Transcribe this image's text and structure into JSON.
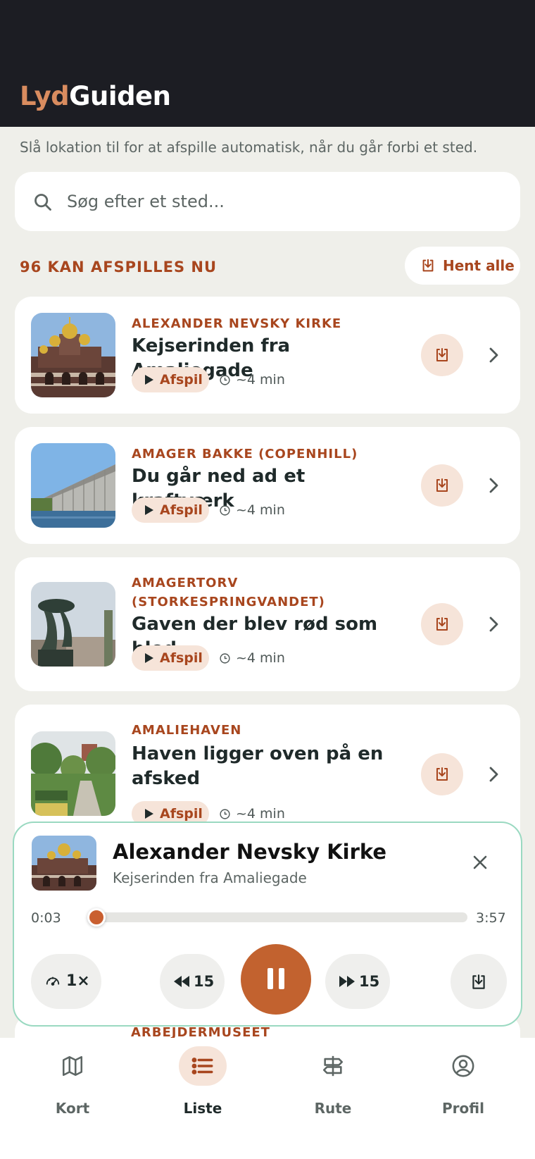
{
  "app": {
    "logo_part1": "Lyd",
    "logo_part2": "Guiden"
  },
  "location_hint": "Slå lokation til for at afspille automatisk, når du går forbi et sted.",
  "search": {
    "placeholder": "Søg efter et sted..."
  },
  "list_header": {
    "count_label": "96 KAN AFSPILLES NU",
    "download_all_label": "Hent alle"
  },
  "items": [
    {
      "category": "ALEXANDER NEVSKY KIRKE",
      "title": "Kejserinden fra Amaliegade",
      "play_label": "Afspil",
      "duration": "~4 min"
    },
    {
      "category": "AMAGER BAKKE (COPENHILL)",
      "title": "Du går ned ad et kraftværk",
      "play_label": "Afspil",
      "duration": "~4 min"
    },
    {
      "category_line1": "AMAGERTORV",
      "category_line2": "(STORKESPRINGVANDET)",
      "title": "Gaven der blev rød som blod",
      "play_label": "Afspil",
      "duration": "~4 min"
    },
    {
      "category": "AMALIEHAVEN",
      "title_line1": "Haven ligger oven på en",
      "title_line2": "afsked",
      "play_label": "Afspil",
      "duration": "~4 min"
    },
    {
      "category": "ARBEJDERMUSEET"
    }
  ],
  "player": {
    "title": "Alexander Nevsky Kirke",
    "subtitle": "Kejserinden fra Amaliegade",
    "current_time": "0:03",
    "total_time": "3:57",
    "progress": 0.013,
    "speed_label": "1×",
    "rewind_label": "15",
    "forward_label": "15",
    "state": "playing"
  },
  "nav": [
    {
      "label": "Kort",
      "icon": "map-icon",
      "active": false
    },
    {
      "label": "Liste",
      "icon": "list-icon",
      "active": true
    },
    {
      "label": "Rute",
      "icon": "signpost-icon",
      "active": false
    },
    {
      "label": "Profil",
      "icon": "user-circle-icon",
      "active": false
    }
  ],
  "colors": {
    "accent": "#a8461e",
    "player_accent": "#c2622f",
    "header_bg": "#1c1d23",
    "page_bg": "#efefea",
    "pill_bg": "#f6e4d9",
    "player_border": "#9ad9c1"
  }
}
